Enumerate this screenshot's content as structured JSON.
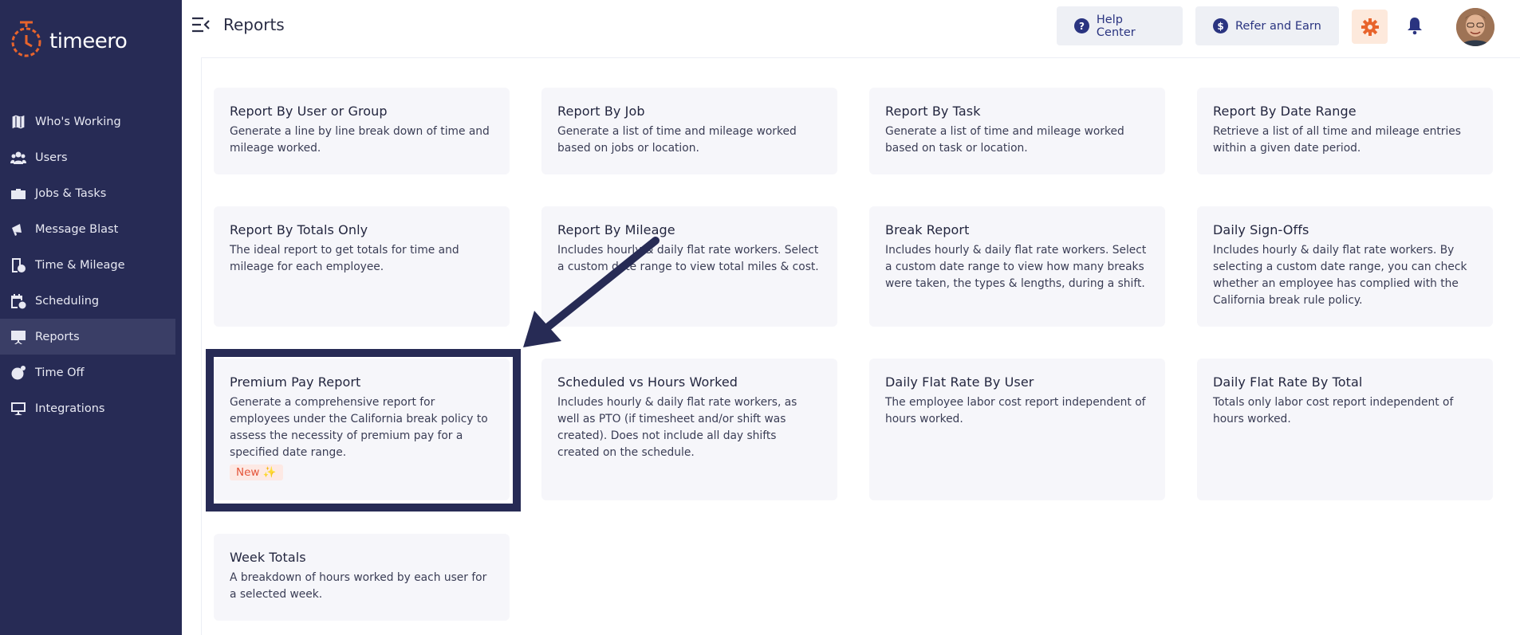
{
  "brand": {
    "name": "timeero"
  },
  "sidebar": {
    "items": [
      {
        "label": "Who's Working",
        "icon": "map-icon"
      },
      {
        "label": "Users",
        "icon": "users-icon"
      },
      {
        "label": "Jobs & Tasks",
        "icon": "briefcase-icon"
      },
      {
        "label": "Message Blast",
        "icon": "megaphone-icon"
      },
      {
        "label": "Time & Mileage",
        "icon": "timesheet-icon"
      },
      {
        "label": "Scheduling",
        "icon": "calendar-icon"
      },
      {
        "label": "Reports",
        "icon": "presentation-icon",
        "active": true
      },
      {
        "label": "Time Off",
        "icon": "time-off-icon"
      },
      {
        "label": "Integrations",
        "icon": "integrations-icon"
      }
    ]
  },
  "header": {
    "title": "Reports",
    "help_label": "Help Center",
    "refer_label": "Refer and Earn"
  },
  "reports": [
    {
      "title": "Report By User or Group",
      "description": "Generate a line by line break down of time and mileage worked."
    },
    {
      "title": "Report By  Job",
      "description": "Generate a list of time and mileage worked based on jobs or location."
    },
    {
      "title": "Report By Task",
      "description": "Generate a list of time and mileage worked based on task or location."
    },
    {
      "title": "Report By Date Range",
      "description": "Retrieve a list of all time and mileage entries within a given date period."
    },
    {
      "title": "Report By Totals Only",
      "description": "The ideal report to get totals for time and mileage for each employee."
    },
    {
      "title": "Report By Mileage",
      "description": "Includes hourly & daily flat rate workers. Select a custom date range to view total miles & cost."
    },
    {
      "title": "Break Report",
      "description": "Includes hourly & daily flat rate workers. Select a custom date range to view how many breaks were taken, the types & lengths, during a shift."
    },
    {
      "title": "Daily Sign-Offs",
      "description": "Includes hourly & daily flat rate workers. By selecting a custom date range, you can check whether an employee has complied with the California break rule policy."
    },
    {
      "title": "Premium Pay Report",
      "description": "Generate a comprehensive report for employees under the California break policy to assess the necessity of premium pay for a specified date range.",
      "badge": "New ✨"
    },
    {
      "title": "Scheduled vs Hours Worked",
      "description": "Includes hourly & daily flat rate workers, as well as PTO (if timesheet and/or shift was created). Does not include all day shifts created on the schedule."
    },
    {
      "title": "Daily Flat Rate By User",
      "description": "The employee labor cost report independent of hours worked."
    },
    {
      "title": "Daily Flat Rate By Total",
      "description": "Totals only labor cost report independent of hours worked."
    },
    {
      "title": "Week Totals",
      "description": "A breakdown of hours worked by each user for a selected week."
    }
  ],
  "colors": {
    "sidebar_bg": "#272b55",
    "accent_orange": "#e8642c",
    "accent_navy": "#2a3480",
    "card_bg": "#f6f6fa",
    "badge_text": "#e4553a"
  }
}
